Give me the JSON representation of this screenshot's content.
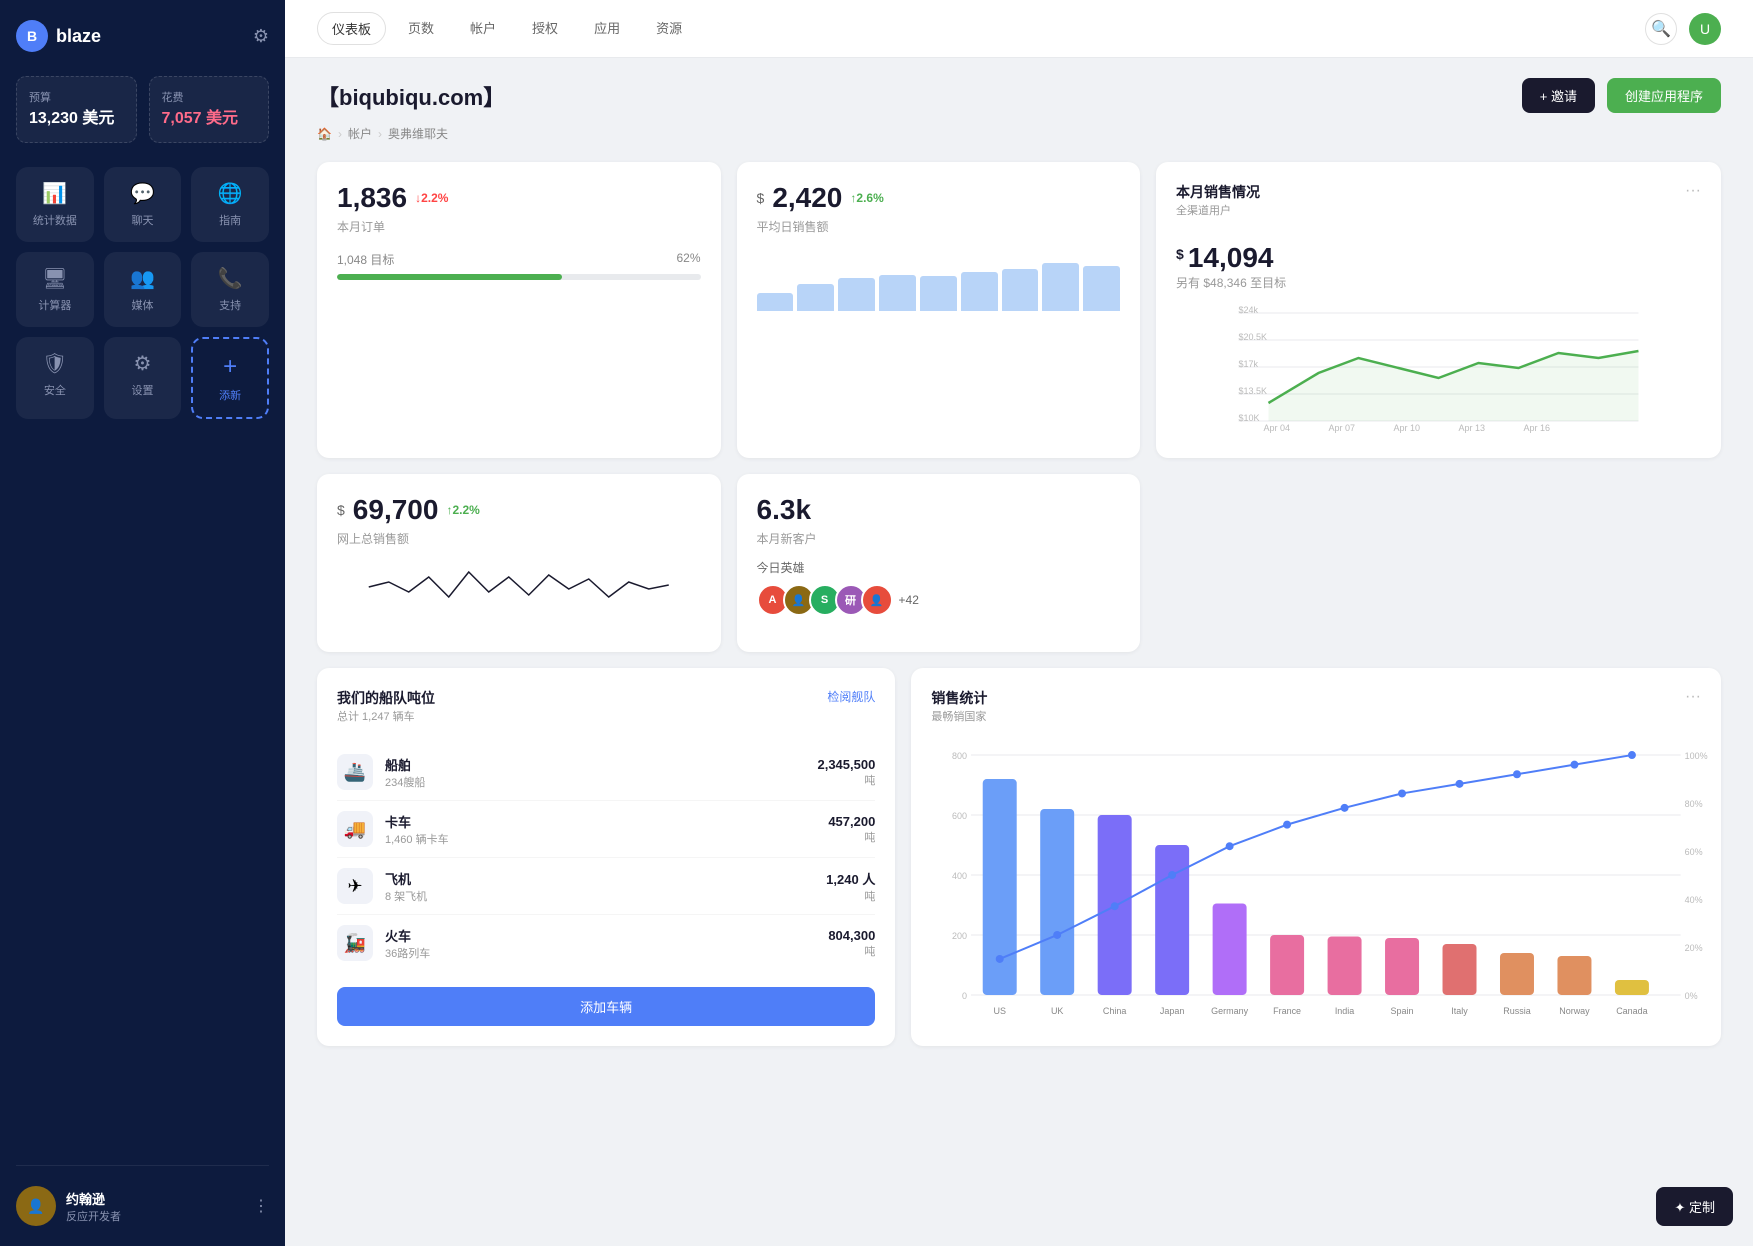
{
  "sidebar": {
    "logo": "blaze",
    "budget": {
      "label": "预算",
      "value": "13,230 美元"
    },
    "expenses": {
      "label": "花费",
      "value": "7,057 美元"
    },
    "nav_items": [
      {
        "id": "stats",
        "label": "统计数据",
        "icon": "📊"
      },
      {
        "id": "chat",
        "label": "聊天",
        "icon": "💬"
      },
      {
        "id": "guide",
        "label": "指南",
        "icon": "🌐"
      },
      {
        "id": "calculator",
        "label": "计算器",
        "icon": "🖥"
      },
      {
        "id": "media",
        "label": "媒体",
        "icon": "👥"
      },
      {
        "id": "support",
        "label": "支持",
        "icon": "📞"
      },
      {
        "id": "security",
        "label": "安全",
        "icon": "🛡"
      },
      {
        "id": "settings",
        "label": "设置",
        "icon": "⚙"
      },
      {
        "id": "add",
        "label": "添新",
        "icon": "+"
      }
    ],
    "user": {
      "name": "约翰逊",
      "role": "反应开发者"
    }
  },
  "top_nav": {
    "tabs": [
      {
        "id": "dashboard",
        "label": "仪表板",
        "active": true
      },
      {
        "id": "pages",
        "label": "页数"
      },
      {
        "id": "accounts",
        "label": "帐户"
      },
      {
        "id": "auth",
        "label": "授权"
      },
      {
        "id": "apps",
        "label": "应用"
      },
      {
        "id": "resources",
        "label": "资源"
      }
    ]
  },
  "page": {
    "title": "【biqubiqu.com】",
    "breadcrumb": [
      "🏠",
      "帐户",
      "奥弗维耶夫"
    ],
    "invite_btn": "+ 邀请",
    "create_btn": "创建应用程序"
  },
  "stats": {
    "orders": {
      "value": "1,836",
      "change": "↓2.2%",
      "change_type": "down",
      "label": "本月订单",
      "progress_label": "1,048 目标",
      "progress_pct": "62%",
      "progress_val": 62
    },
    "daily_sales": {
      "prefix": "$",
      "value": "2,420",
      "change": "↑2.6%",
      "change_type": "up",
      "label": "平均日销售额",
      "bars": [
        30,
        45,
        55,
        60,
        58,
        65,
        70,
        80,
        75
      ]
    },
    "monthly_sales": {
      "title": "本月销售情况",
      "subtitle": "全渠道用户",
      "prefix": "$",
      "value": "14,094",
      "sub": "另有 $48,346 至目标",
      "y_labels": [
        "$24k",
        "$20.5K",
        "$17k",
        "$13.5K",
        "$10K"
      ],
      "x_labels": [
        "Apr 04",
        "Apr 07",
        "Apr 10",
        "Apr 13",
        "Apr 16"
      ]
    }
  },
  "second_row": {
    "total_sales": {
      "prefix": "$",
      "value": "69,700",
      "change": "↑2.2%",
      "change_type": "up",
      "label": "网上总销售额"
    },
    "new_customers": {
      "value": "6.3k",
      "label": "本月新客户",
      "heroes_label": "今日英雄",
      "heroes_count": "+42"
    }
  },
  "fleet": {
    "title": "我们的船队吨位",
    "subtitle": "总计 1,247 辆车",
    "link": "检阅舰队",
    "items": [
      {
        "name": "船舶",
        "count": "234艘船",
        "value": "2,345,500",
        "unit": "吨",
        "icon": "🚢"
      },
      {
        "name": "卡车",
        "count": "1,460 辆卡车",
        "value": "457,200",
        "unit": "吨",
        "icon": "🚚"
      },
      {
        "name": "飞机",
        "count": "8 架飞机",
        "value": "1,240 人",
        "unit": "吨",
        "icon": "✈"
      },
      {
        "name": "火车",
        "count": "36路列车",
        "value": "804,300",
        "unit": "吨",
        "icon": "🚂"
      }
    ],
    "add_btn": "添加车辆"
  },
  "sales_stats": {
    "title": "销售统计",
    "subtitle": "最畅销国家",
    "countries": [
      "US",
      "UK",
      "China",
      "Japan",
      "Germany",
      "France",
      "India",
      "Spain",
      "Italy",
      "Russia",
      "Norway",
      "Canada"
    ],
    "values": [
      720,
      620,
      600,
      500,
      305,
      200,
      195,
      190,
      170,
      140,
      130,
      50
    ],
    "colors": [
      "#6b9ef8",
      "#6b9ef8",
      "#7b6ef8",
      "#7b6ef8",
      "#b06ef8",
      "#e86ea0",
      "#e86ea0",
      "#e86ea0",
      "#e07070",
      "#e09060",
      "#e09060",
      "#e0c040"
    ],
    "cumulative": [
      15,
      25,
      37,
      50,
      62,
      71,
      78,
      84,
      88,
      92,
      96,
      100
    ]
  },
  "customize_btn": "✦ 定制"
}
